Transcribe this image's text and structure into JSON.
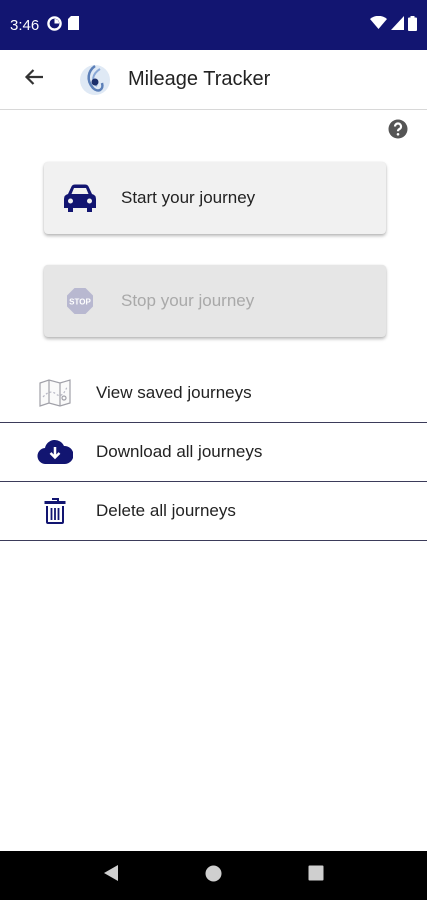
{
  "status_bar": {
    "time": "3:46",
    "left_icons": [
      "data-saver-icon",
      "sd-card-icon"
    ],
    "right_icons": [
      "wifi-icon",
      "signal-icon",
      "battery-icon"
    ],
    "background": "#121571"
  },
  "app_bar": {
    "title": "Mileage Tracker",
    "back_icon": "arrow-back-icon",
    "logo_icon": "app-logo-icon"
  },
  "help": {
    "icon": "help-circle-icon"
  },
  "actions": {
    "start": {
      "label": "Start your journey",
      "icon": "car-icon",
      "enabled": true
    },
    "stop": {
      "label": "Stop your journey",
      "icon": "stop-sign-icon",
      "enabled": false
    }
  },
  "menu": [
    {
      "label": "View saved journeys",
      "icon": "map-icon"
    },
    {
      "label": "Download all journeys",
      "icon": "cloud-download-icon"
    },
    {
      "label": "Delete all journeys",
      "icon": "trash-icon"
    }
  ],
  "nav_bar": {
    "buttons": [
      "back-triangle-icon",
      "home-circle-icon",
      "recents-square-icon"
    ]
  },
  "colors": {
    "accent": "#121571",
    "disabled_text": "#a9a9a9"
  }
}
